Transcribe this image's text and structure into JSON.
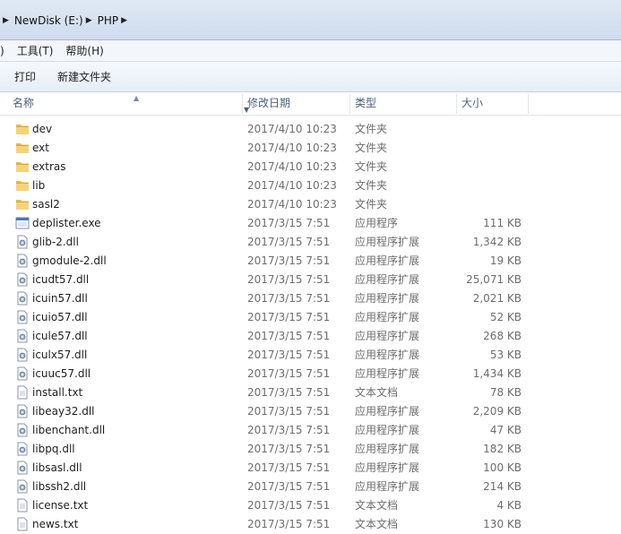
{
  "address": {
    "crumbs": [
      "NewDisk (E:)",
      "PHP"
    ]
  },
  "menu": {
    "items": [
      ")",
      "工具(T)",
      "帮助(H)"
    ]
  },
  "toolbar": {
    "print_label": "打印",
    "new_folder_label": "新建文件夹"
  },
  "columns": {
    "name": "名称",
    "date": "修改日期",
    "type": "类型",
    "size": "大小"
  },
  "files": [
    {
      "name": "dev",
      "date": "2017/4/10 10:23",
      "type": "文件夹",
      "size": "",
      "icon": "folder-icon"
    },
    {
      "name": "ext",
      "date": "2017/4/10 10:23",
      "type": "文件夹",
      "size": "",
      "icon": "folder-icon"
    },
    {
      "name": "extras",
      "date": "2017/4/10 10:23",
      "type": "文件夹",
      "size": "",
      "icon": "folder-icon"
    },
    {
      "name": "lib",
      "date": "2017/4/10 10:23",
      "type": "文件夹",
      "size": "",
      "icon": "folder-icon"
    },
    {
      "name": "sasl2",
      "date": "2017/4/10 10:23",
      "type": "文件夹",
      "size": "",
      "icon": "folder-icon"
    },
    {
      "name": "deplister.exe",
      "date": "2017/3/15 7:51",
      "type": "应用程序",
      "size": "111 KB",
      "icon": "exe-icon"
    },
    {
      "name": "glib-2.dll",
      "date": "2017/3/15 7:51",
      "type": "应用程序扩展",
      "size": "1,342 KB",
      "icon": "dll-icon"
    },
    {
      "name": "gmodule-2.dll",
      "date": "2017/3/15 7:51",
      "type": "应用程序扩展",
      "size": "19 KB",
      "icon": "dll-icon"
    },
    {
      "name": "icudt57.dll",
      "date": "2017/3/15 7:51",
      "type": "应用程序扩展",
      "size": "25,071 KB",
      "icon": "dll-icon"
    },
    {
      "name": "icuin57.dll",
      "date": "2017/3/15 7:51",
      "type": "应用程序扩展",
      "size": "2,021 KB",
      "icon": "dll-icon"
    },
    {
      "name": "icuio57.dll",
      "date": "2017/3/15 7:51",
      "type": "应用程序扩展",
      "size": "52 KB",
      "icon": "dll-icon"
    },
    {
      "name": "icule57.dll",
      "date": "2017/3/15 7:51",
      "type": "应用程序扩展",
      "size": "268 KB",
      "icon": "dll-icon"
    },
    {
      "name": "iculx57.dll",
      "date": "2017/3/15 7:51",
      "type": "应用程序扩展",
      "size": "53 KB",
      "icon": "dll-icon"
    },
    {
      "name": "icuuc57.dll",
      "date": "2017/3/15 7:51",
      "type": "应用程序扩展",
      "size": "1,434 KB",
      "icon": "dll-icon"
    },
    {
      "name": "install.txt",
      "date": "2017/3/15 7:51",
      "type": "文本文档",
      "size": "78 KB",
      "icon": "txt-icon"
    },
    {
      "name": "libeay32.dll",
      "date": "2017/3/15 7:51",
      "type": "应用程序扩展",
      "size": "2,209 KB",
      "icon": "dll-icon"
    },
    {
      "name": "libenchant.dll",
      "date": "2017/3/15 7:51",
      "type": "应用程序扩展",
      "size": "47 KB",
      "icon": "dll-icon"
    },
    {
      "name": "libpq.dll",
      "date": "2017/3/15 7:51",
      "type": "应用程序扩展",
      "size": "182 KB",
      "icon": "dll-icon"
    },
    {
      "name": "libsasl.dll",
      "date": "2017/3/15 7:51",
      "type": "应用程序扩展",
      "size": "100 KB",
      "icon": "dll-icon"
    },
    {
      "name": "libssh2.dll",
      "date": "2017/3/15 7:51",
      "type": "应用程序扩展",
      "size": "214 KB",
      "icon": "dll-icon"
    },
    {
      "name": "license.txt",
      "date": "2017/3/15 7:51",
      "type": "文本文档",
      "size": "4 KB",
      "icon": "txt-icon"
    },
    {
      "name": "news.txt",
      "date": "2017/3/15 7:51",
      "type": "文本文档",
      "size": "130 KB",
      "icon": "txt-icon"
    }
  ]
}
